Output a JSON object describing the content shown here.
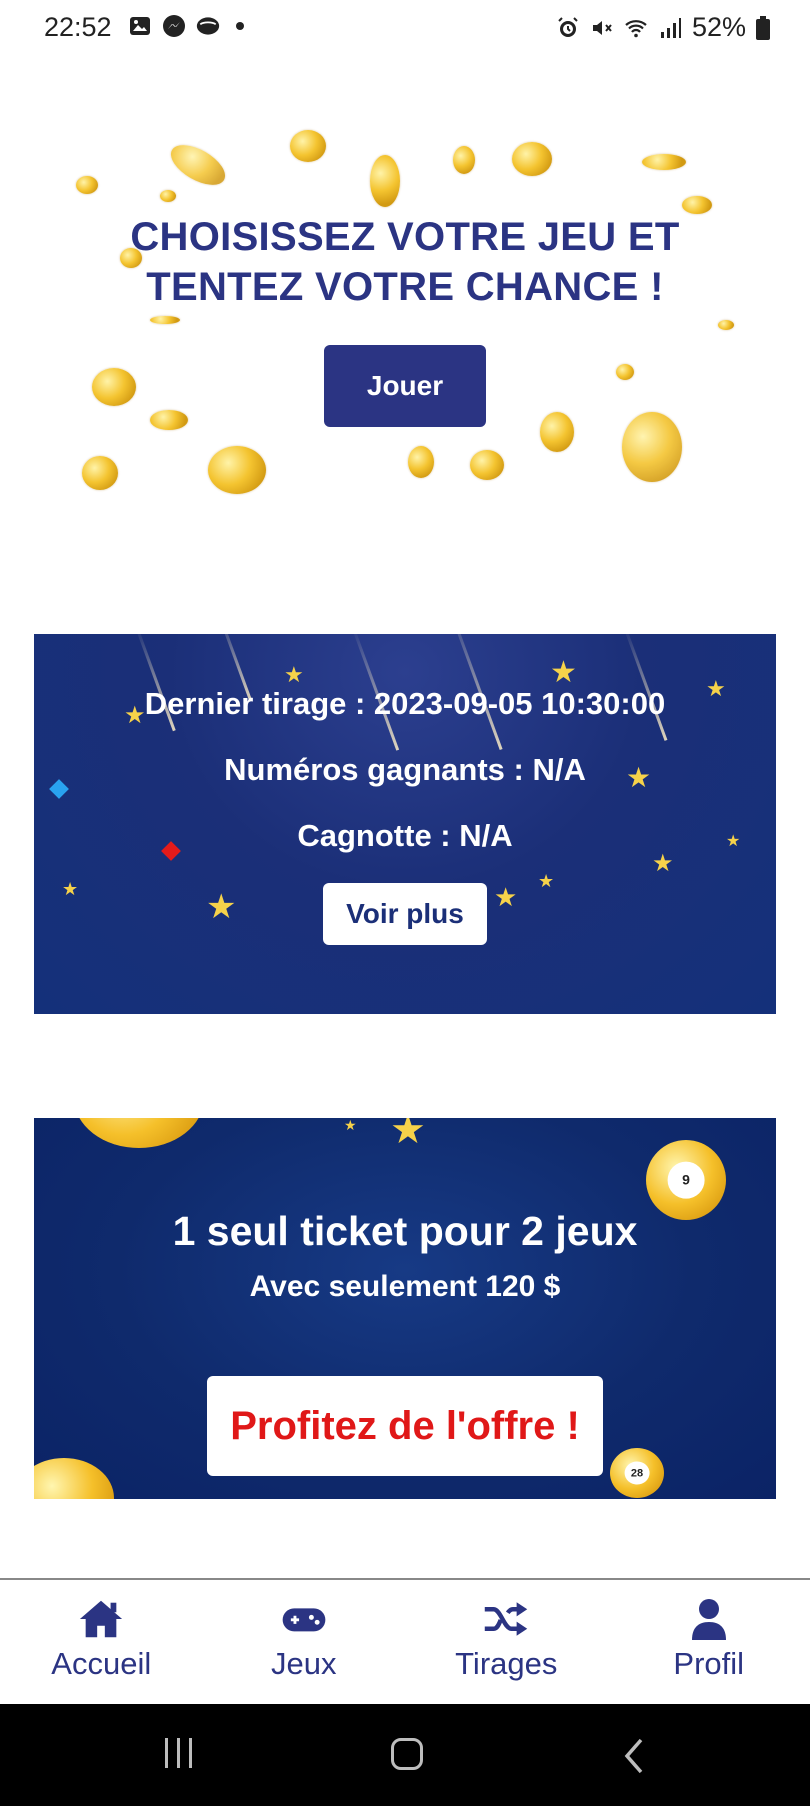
{
  "status_bar": {
    "time": "22:52",
    "left_icons": [
      "gallery-icon",
      "messenger-icon",
      "cloud-icon",
      "dot"
    ],
    "right_icons": [
      "alarm-icon",
      "mute-icon",
      "wifi-icon",
      "signal-icon"
    ],
    "battery": "52%"
  },
  "hero": {
    "title_line1": "CHOISISSEZ VOTRE JEU ET",
    "title_line2": "TENTEZ VOTRE CHANCE !",
    "play_label": "Jouer"
  },
  "draw_card": {
    "last_draw": "Dernier tirage : 2023-09-05 10:30:00",
    "winning_numbers": "Numéros gagnants : N/A",
    "jackpot": "Cagnotte : N/A",
    "more_label": "Voir plus"
  },
  "offer_card": {
    "title": "1 seul ticket pour 2 jeux",
    "subtitle": "Avec seulement 120 $",
    "cta_label": "Profitez de l'offre !",
    "ball_numbers": [
      "9",
      "28"
    ]
  },
  "bottom_nav": {
    "items": [
      {
        "label": "Accueil",
        "icon": "home-icon"
      },
      {
        "label": "Jeux",
        "icon": "gamepad-icon"
      },
      {
        "label": "Tirages",
        "icon": "shuffle-icon"
      },
      {
        "label": "Profil",
        "icon": "user-icon"
      }
    ]
  },
  "colors": {
    "brand_navy": "#2b3483",
    "card_blue": "#1b2f78",
    "cta_red": "#e01818",
    "coin_gold": "#f4c430"
  }
}
